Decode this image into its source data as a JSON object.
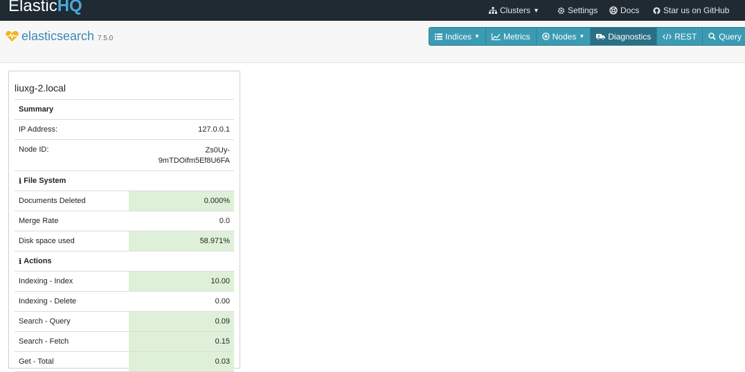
{
  "app": {
    "brand_part1": "Elastic",
    "brand_part2": "HQ"
  },
  "topnav": {
    "clusters": "Clusters",
    "settings": "Settings",
    "docs": "Docs",
    "github": "Star us on GitHub"
  },
  "es": {
    "name": "elasticsearch",
    "version": "7.5.0"
  },
  "toolbar": {
    "indices": "Indices",
    "metrics": "Metrics",
    "nodes": "Nodes",
    "diagnostics": "Diagnostics",
    "rest": "REST",
    "query": "Query"
  },
  "node": {
    "title": "liuxg-2.local",
    "summary_label": "Summary",
    "ip_label": "IP Address:",
    "ip_value": "127.0.0.1",
    "nodeid_label": "Node ID:",
    "nodeid_line1": "Zs0Uy-",
    "nodeid_line2": "9mTDOifm5Ef8U6FA"
  },
  "filesystem": {
    "header": "File System",
    "rows": [
      {
        "label": "Documents Deleted",
        "value": "0.000%"
      },
      {
        "label": "Merge Rate",
        "value": "0.0"
      },
      {
        "label": "Disk space used",
        "value": "58.971%"
      }
    ]
  },
  "actions": {
    "header": "Actions",
    "rows": [
      {
        "label": "Indexing - Index",
        "value": "10.00"
      },
      {
        "label": "Indexing - Delete",
        "value": "0.00"
      },
      {
        "label": "Search - Query",
        "value": "0.09"
      },
      {
        "label": "Search - Fetch",
        "value": "0.15"
      },
      {
        "label": "Get - Total",
        "value": "0.03"
      }
    ]
  },
  "colors": {
    "navbar": "#1f2a33",
    "brand_accent": "#4aa8d8",
    "button": "#3b9bb3",
    "button_active": "#2a6f86",
    "highlight": "#dff0d8"
  }
}
